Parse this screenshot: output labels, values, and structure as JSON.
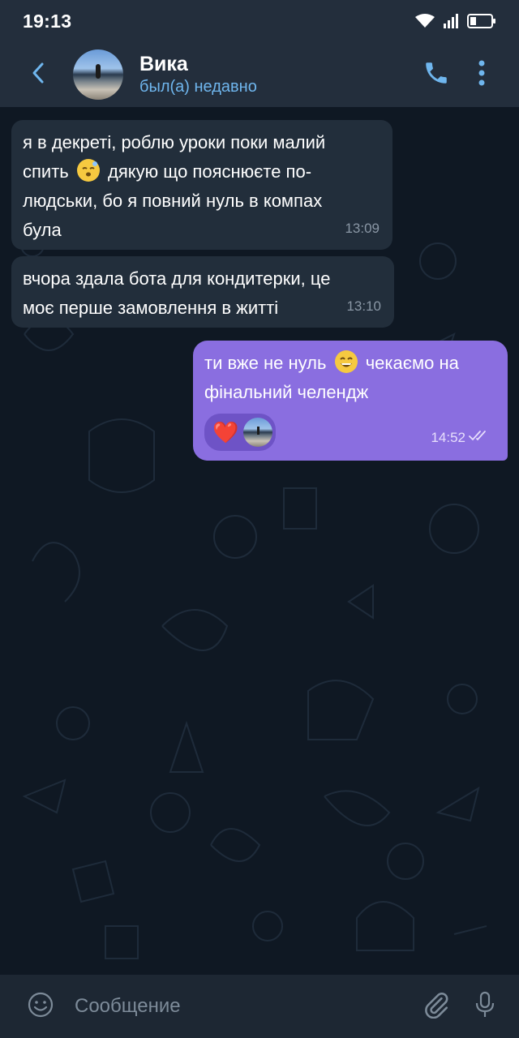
{
  "status_bar": {
    "time": "19:13",
    "icons": [
      "wifi-icon",
      "signal-icon",
      "battery-icon"
    ]
  },
  "header": {
    "contact_name": "Вика",
    "contact_status": "был(а) недавно",
    "icons": [
      "back-arrow-icon",
      "avatar",
      "phone-icon",
      "more-vertical-icon"
    ]
  },
  "messages": [
    {
      "direction": "incoming",
      "lines": [
        "я в декреті, роблю уроки поки малий",
        "спить",
        "дякую що пояснюєте по-",
        "людськи, бо я повний нуль в компах",
        "була"
      ],
      "emoji": "sleepy-face-emoji",
      "time": "13:09"
    },
    {
      "direction": "incoming",
      "lines": [
        "вчора здала бота для кондитерки, це",
        "моє перше замовлення в житті"
      ],
      "time": "13:10"
    },
    {
      "direction": "outgoing",
      "lines": [
        "ти вже не нуль",
        "чекаємо на",
        "фінальний челендж"
      ],
      "emoji": "grinning-face-emoji",
      "reaction": "❤️",
      "time": "14:52",
      "status": "read-double-check"
    }
  ],
  "input": {
    "placeholder": "Сообщение",
    "value": ""
  },
  "colors": {
    "header_bg": "#232e3c",
    "chat_bg": "#0f1823",
    "incoming_bubble": "#222e3b",
    "outgoing_bubble": "#8a6ee0",
    "accent": "#5ea9eb"
  }
}
